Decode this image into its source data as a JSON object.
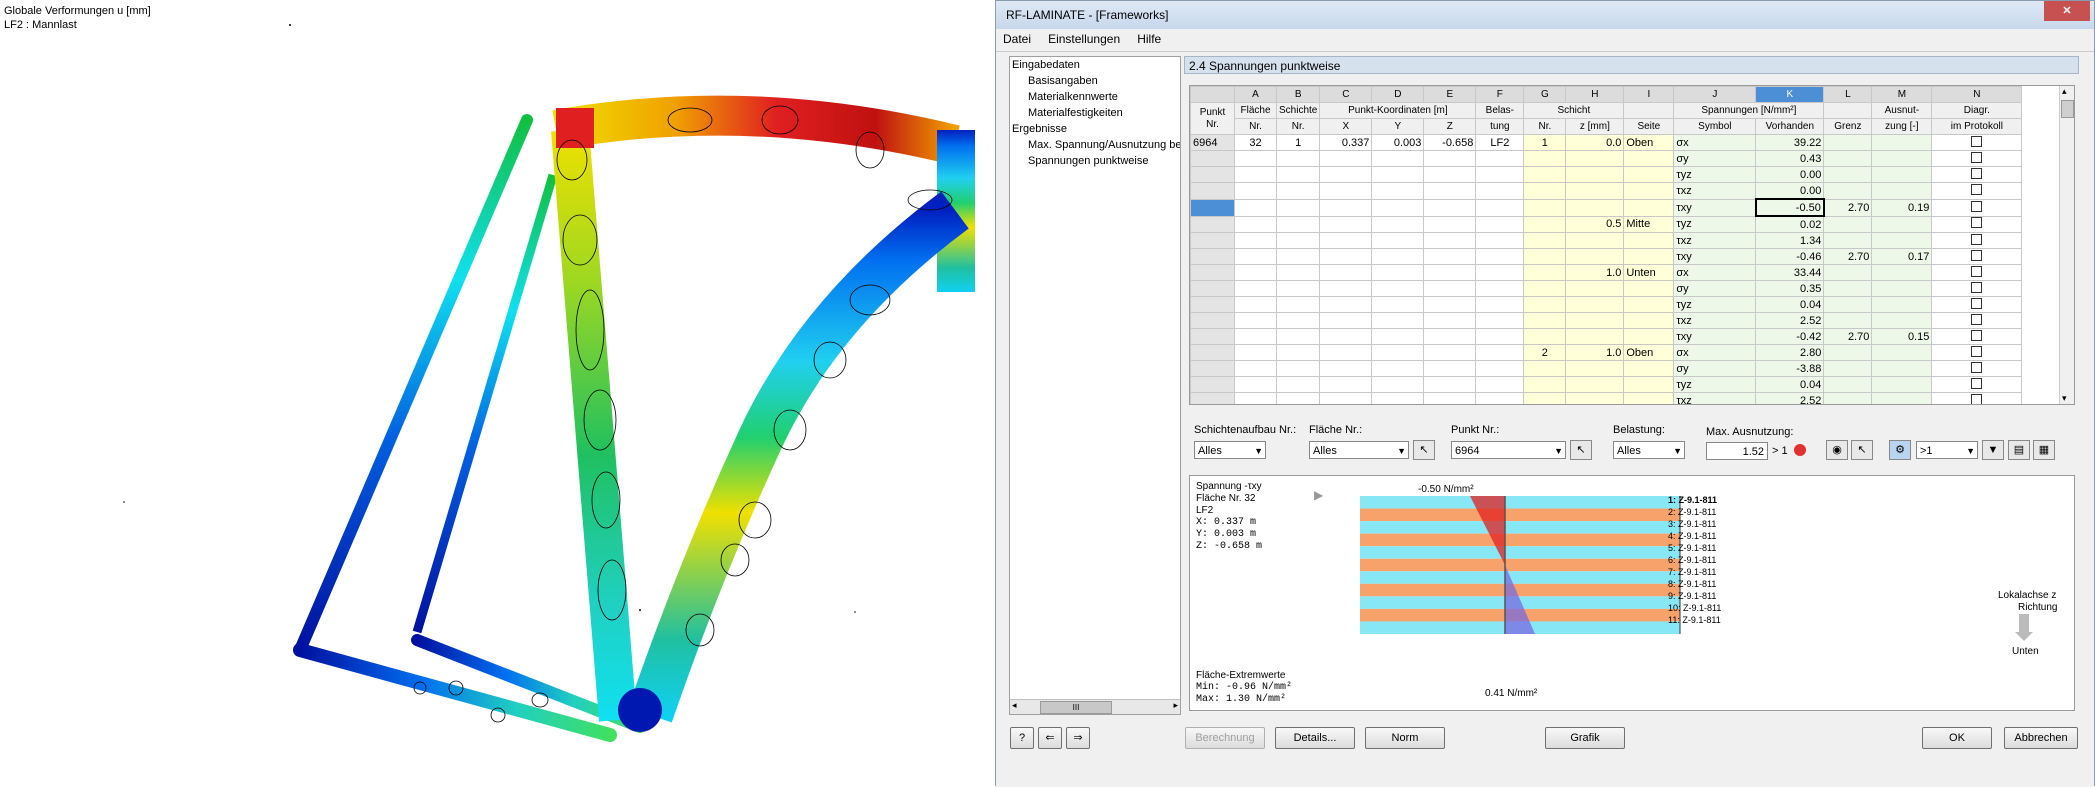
{
  "viewport": {
    "title_line1": "Globale Verformungen u [mm]",
    "title_line2": "LF2 : Mannlast"
  },
  "window": {
    "title": "RF-LAMINATE - [Frameworks]",
    "close_label": "✕"
  },
  "menu": [
    "Datei",
    "Einstellungen",
    "Hilfe"
  ],
  "nav": {
    "root_input": "Eingabedaten",
    "input_items": [
      "Basisangaben",
      "Materialkennwerte",
      "Materialfestigkeiten"
    ],
    "root_results": "Ergebnisse",
    "result_items": [
      "Max. Spannung/Ausnutzung be",
      "Spannungen punktweise"
    ],
    "scroll_grip": "III"
  },
  "section_title": "2.4 Spannungen punktweise",
  "table": {
    "col_letters": [
      "A",
      "B",
      "C",
      "D",
      "E",
      "F",
      "G",
      "H",
      "I",
      "J",
      "K",
      "L",
      "M",
      "N"
    ],
    "hdr": {
      "punkt": "Punkt",
      "nr": "Nr.",
      "flaeche": "Fläche",
      "schichte": "Schichte",
      "koord": "Punkt-Koordinaten [m]",
      "x": "X",
      "y": "Y",
      "z": "Z",
      "belas": "Belas-",
      "tung": "tung",
      "schicht": "Schicht",
      "z_mm": "z [mm]",
      "seite": "Seite",
      "spannungen": "Spannungen [N/mm²]",
      "symbol": "Symbol",
      "vorhanden": "Vorhanden",
      "grenz": "Grenz",
      "ausnut": "Ausnut-",
      "zung": "zung [-]",
      "diagr": "Diagr.",
      "protokoll": "im Protokoll"
    },
    "rows": [
      {
        "punkt": "6964",
        "flaeche": "32",
        "schichte": "1",
        "x": "0.337",
        "y": "0.003",
        "z": "-0.658",
        "lf": "LF2",
        "nr": "1",
        "zmm": "0.0",
        "seite": "Oben",
        "sym": "σx",
        "vorh": "39.22",
        "grenz": "",
        "ausn": ""
      },
      {
        "punkt": "",
        "flaeche": "",
        "schichte": "",
        "x": "",
        "y": "",
        "z": "",
        "lf": "",
        "nr": "",
        "zmm": "",
        "seite": "",
        "sym": "σy",
        "vorh": "0.43",
        "grenz": "",
        "ausn": ""
      },
      {
        "punkt": "",
        "flaeche": "",
        "schichte": "",
        "x": "",
        "y": "",
        "z": "",
        "lf": "",
        "nr": "",
        "zmm": "",
        "seite": "",
        "sym": "τyz",
        "vorh": "0.00",
        "grenz": "",
        "ausn": ""
      },
      {
        "punkt": "",
        "flaeche": "",
        "schichte": "",
        "x": "",
        "y": "",
        "z": "",
        "lf": "",
        "nr": "",
        "zmm": "",
        "seite": "",
        "sym": "τxz",
        "vorh": "0.00",
        "grenz": "",
        "ausn": ""
      },
      {
        "punkt": "",
        "flaeche": "",
        "schichte": "",
        "x": "",
        "y": "",
        "z": "",
        "lf": "",
        "nr": "",
        "zmm": "",
        "seite": "",
        "sym": "τxy",
        "vorh": "-0.50",
        "grenz": "2.70",
        "ausn": "0.19"
      },
      {
        "punkt": "",
        "flaeche": "",
        "schichte": "",
        "x": "",
        "y": "",
        "z": "",
        "lf": "",
        "nr": "",
        "zmm": "0.5",
        "seite": "Mitte",
        "sym": "τyz",
        "vorh": "0.02",
        "grenz": "",
        "ausn": ""
      },
      {
        "punkt": "",
        "flaeche": "",
        "schichte": "",
        "x": "",
        "y": "",
        "z": "",
        "lf": "",
        "nr": "",
        "zmm": "",
        "seite": "",
        "sym": "τxz",
        "vorh": "1.34",
        "grenz": "",
        "ausn": ""
      },
      {
        "punkt": "",
        "flaeche": "",
        "schichte": "",
        "x": "",
        "y": "",
        "z": "",
        "lf": "",
        "nr": "",
        "zmm": "",
        "seite": "",
        "sym": "τxy",
        "vorh": "-0.46",
        "grenz": "2.70",
        "ausn": "0.17"
      },
      {
        "punkt": "",
        "flaeche": "",
        "schichte": "",
        "x": "",
        "y": "",
        "z": "",
        "lf": "",
        "nr": "",
        "zmm": "1.0",
        "seite": "Unten",
        "sym": "σx",
        "vorh": "33.44",
        "grenz": "",
        "ausn": ""
      },
      {
        "punkt": "",
        "flaeche": "",
        "schichte": "",
        "x": "",
        "y": "",
        "z": "",
        "lf": "",
        "nr": "",
        "zmm": "",
        "seite": "",
        "sym": "σy",
        "vorh": "0.35",
        "grenz": "",
        "ausn": ""
      },
      {
        "punkt": "",
        "flaeche": "",
        "schichte": "",
        "x": "",
        "y": "",
        "z": "",
        "lf": "",
        "nr": "",
        "zmm": "",
        "seite": "",
        "sym": "τyz",
        "vorh": "0.04",
        "grenz": "",
        "ausn": ""
      },
      {
        "punkt": "",
        "flaeche": "",
        "schichte": "",
        "x": "",
        "y": "",
        "z": "",
        "lf": "",
        "nr": "",
        "zmm": "",
        "seite": "",
        "sym": "τxz",
        "vorh": "2.52",
        "grenz": "",
        "ausn": ""
      },
      {
        "punkt": "",
        "flaeche": "",
        "schichte": "",
        "x": "",
        "y": "",
        "z": "",
        "lf": "",
        "nr": "",
        "zmm": "",
        "seite": "",
        "sym": "τxy",
        "vorh": "-0.42",
        "grenz": "2.70",
        "ausn": "0.15"
      },
      {
        "punkt": "",
        "flaeche": "",
        "schichte": "",
        "x": "",
        "y": "",
        "z": "",
        "lf": "",
        "nr": "2",
        "zmm": "1.0",
        "seite": "Oben",
        "sym": "σx",
        "vorh": "2.80",
        "grenz": "",
        "ausn": ""
      },
      {
        "punkt": "",
        "flaeche": "",
        "schichte": "",
        "x": "",
        "y": "",
        "z": "",
        "lf": "",
        "nr": "",
        "zmm": "",
        "seite": "",
        "sym": "σy",
        "vorh": "-3.88",
        "grenz": "",
        "ausn": ""
      },
      {
        "punkt": "",
        "flaeche": "",
        "schichte": "",
        "x": "",
        "y": "",
        "z": "",
        "lf": "",
        "nr": "",
        "zmm": "",
        "seite": "",
        "sym": "τyz",
        "vorh": "0.04",
        "grenz": "",
        "ausn": ""
      },
      {
        "punkt": "",
        "flaeche": "",
        "schichte": "",
        "x": "",
        "y": "",
        "z": "",
        "lf": "",
        "nr": "",
        "zmm": "",
        "seite": "",
        "sym": "τxz",
        "vorh": "2.52",
        "grenz": "",
        "ausn": ""
      }
    ]
  },
  "filters": {
    "schichtenaufbau_label": "Schichtenaufbau Nr.:",
    "schichtenaufbau_value": "Alles",
    "flaeche_label": "Fläche Nr.:",
    "flaeche_value": "Alles",
    "punkt_label": "Punkt Nr.:",
    "punkt_value": "6964",
    "belastung_label": "Belastung:",
    "belastung_value": "Alles",
    "max_label": "Max. Ausnutzung:",
    "max_value": "1.52",
    "max_cmp": "> 1",
    "filter_value": ">1"
  },
  "graphic": {
    "heading": "Spannung -τxy",
    "flaeche": "Fläche Nr. 32",
    "lf": "LF2",
    "x": "X:  0.337  m",
    "y": "Y:  0.003  m",
    "z": "Z: -0.658  m",
    "top_value": "-0.50 N/mm²",
    "bottom_value": "0.41 N/mm²",
    "extreme_title": "Fläche-Extremwerte",
    "extreme_min": "Min:  -0.96 N/mm²",
    "extreme_max": "Max:   1.30 N/mm²",
    "layers": [
      "1: Z-9.1-811",
      "2: Z-9.1-811",
      "3: Z-9.1-811",
      "4: Z-9.1-811",
      "5: Z-9.1-811",
      "6: Z-9.1-811",
      "7: Z-9.1-811",
      "8: Z-9.1-811",
      "9: Z-9.1-811",
      "10: Z-9.1-811",
      "11: Z-9.1-811"
    ],
    "axis_label": "Lokalachse z",
    "axis_dir": "Richtung",
    "axis_down": "Unten",
    "colors": {
      "layer_a": "#87e7f5",
      "layer_b": "#f6a26a",
      "neg": "#e02020",
      "pos": "#7a6ae0"
    }
  },
  "buttons": {
    "berechnung": "Berechnung",
    "details": "Details...",
    "norm": "Norm",
    "grafik": "Grafik",
    "ok": "OK",
    "abbrechen": "Abbrechen"
  }
}
